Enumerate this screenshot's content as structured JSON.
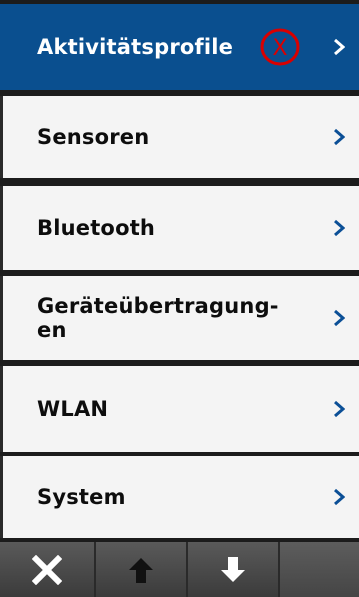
{
  "menu": {
    "items": [
      {
        "label": "Aktivitätsprofile",
        "selected": true
      },
      {
        "label": "Sensoren"
      },
      {
        "label": "Bluetooth"
      },
      {
        "label": "Geräteübertragung-\nen"
      },
      {
        "label": "WLAN"
      },
      {
        "label": "System"
      }
    ],
    "marker": "X"
  },
  "toolbar": {
    "buttons": [
      {
        "icon": "close-icon"
      },
      {
        "icon": "arrow-up-icon"
      },
      {
        "icon": "arrow-down-icon"
      }
    ]
  },
  "colors": {
    "selected_bg": "#0a4f8f",
    "chevron": "#0b4f96",
    "marker": "#d90000"
  }
}
